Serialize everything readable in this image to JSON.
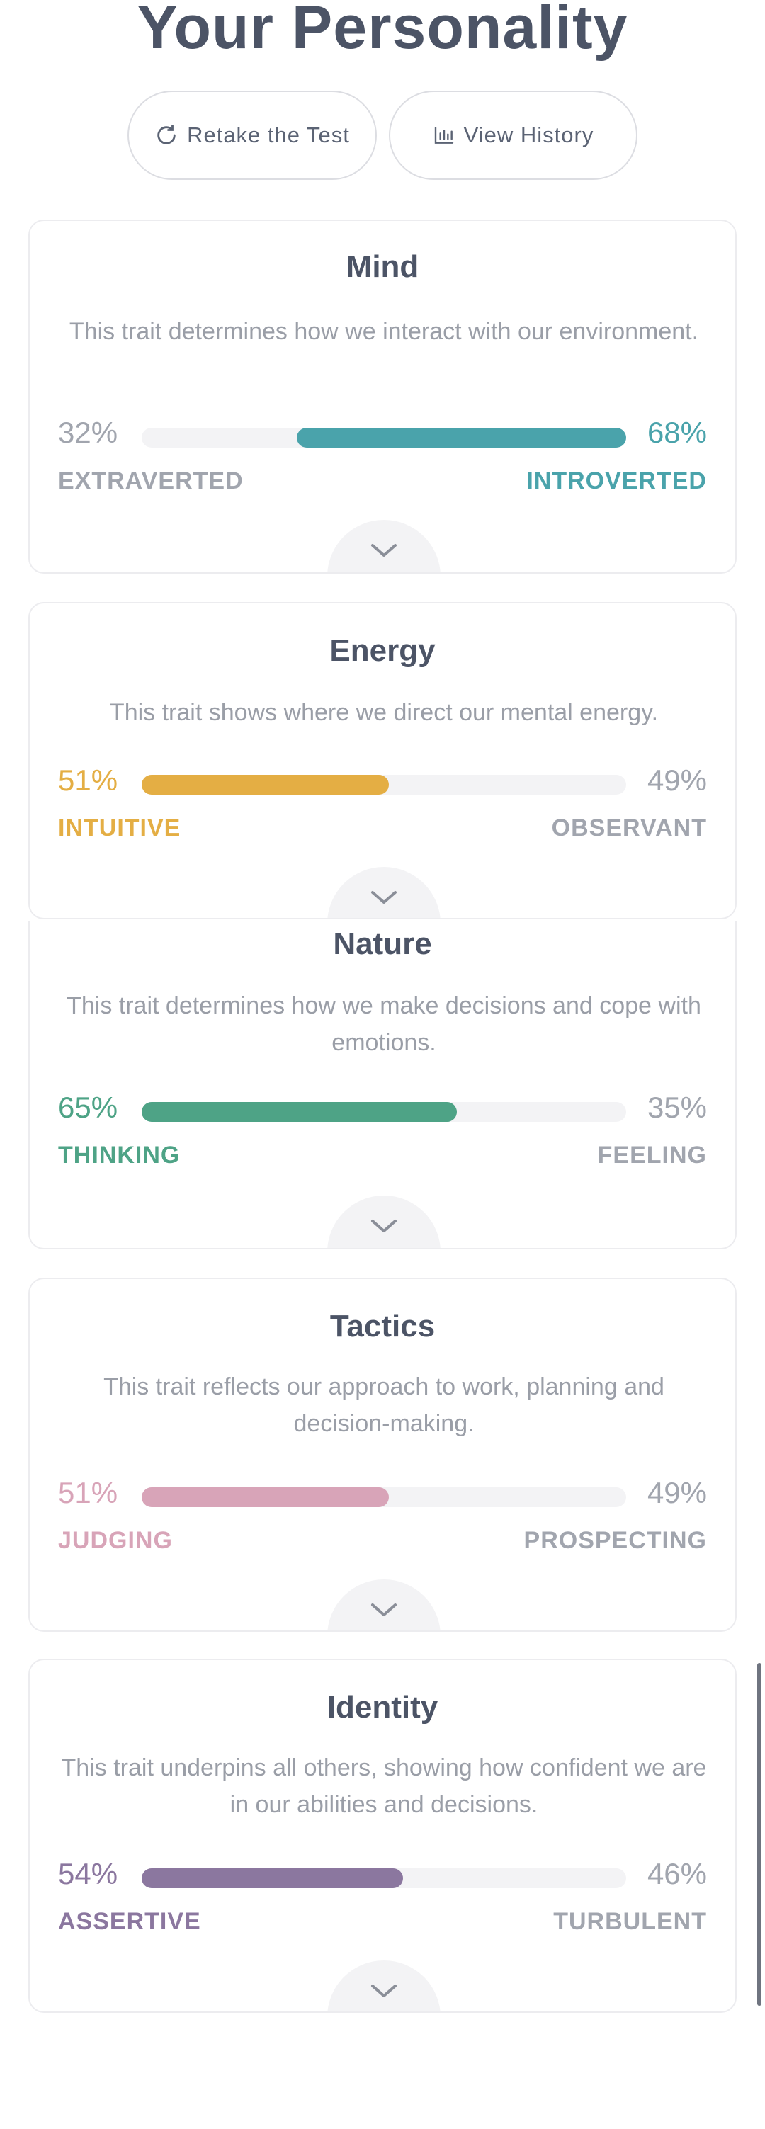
{
  "header": {
    "title": "Your Personality",
    "retake_label": "Retake the Test",
    "history_label": "View History"
  },
  "icons": {
    "retake": "refresh-icon",
    "history": "bar-chart-icon",
    "expand": "chevron-down-icon"
  },
  "traits": [
    {
      "title": "Mind",
      "description": "This trait determines how we interact with our environment.",
      "left_percent": "32%",
      "right_percent": "68%",
      "left_label": "EXTRAVERTED",
      "right_label": "INTROVERTED",
      "dominant": "right",
      "fill_fraction": 0.68,
      "color": "#4aa3ab"
    },
    {
      "title": "Energy",
      "description": "This trait shows where we direct our mental energy.",
      "left_percent": "51%",
      "right_percent": "49%",
      "left_label": "INTUITIVE",
      "right_label": "OBSERVANT",
      "dominant": "left",
      "fill_fraction": 0.51,
      "color": "#e4ae44"
    },
    {
      "title": "Nature",
      "description": "This trait determines how we make decisions and cope with emotions.",
      "left_percent": "65%",
      "right_percent": "35%",
      "left_label": "THINKING",
      "right_label": "FEELING",
      "dominant": "left",
      "fill_fraction": 0.65,
      "color": "#4ea386"
    },
    {
      "title": "Tactics",
      "description": "This trait reflects our approach to work, planning and decision-making.",
      "left_percent": "51%",
      "right_percent": "49%",
      "left_label": "JUDGING",
      "right_label": "PROSPECTING",
      "dominant": "left",
      "fill_fraction": 0.51,
      "color": "#d8a4b8"
    },
    {
      "title": "Identity",
      "description": "This trait underpins all others, showing how confident we are in our abilities and decisions.",
      "left_percent": "54%",
      "right_percent": "46%",
      "left_label": "ASSERTIVE",
      "right_label": "TURBULENT",
      "dominant": "left",
      "fill_fraction": 0.54,
      "color": "#8b779f"
    }
  ]
}
